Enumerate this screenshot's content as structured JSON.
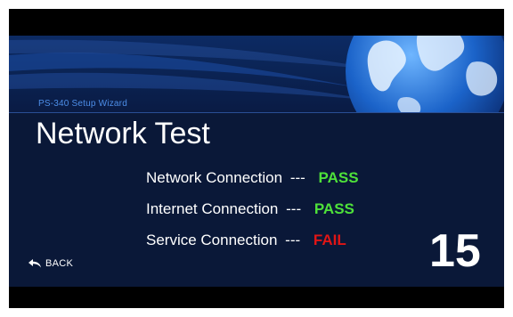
{
  "wizard": {
    "title": "PS-340 Setup Wizard"
  },
  "page": {
    "title": "Network Test"
  },
  "results": [
    {
      "label": "Network Connection",
      "separator": "---",
      "status": "PASS",
      "state": "pass"
    },
    {
      "label": "Internet Connection",
      "separator": "---",
      "status": "PASS",
      "state": "pass"
    },
    {
      "label": "Service Connection",
      "separator": "---",
      "status": "FAIL",
      "state": "fail"
    }
  ],
  "countdown": "15",
  "nav": {
    "back_label": "BACK",
    "back_icon": "back-arrow-icon"
  },
  "colors": {
    "background": "#0a1838",
    "header": "#0c2a63",
    "accent_text": "#4d8ee8",
    "pass": "#4ee13a",
    "fail": "#e01515"
  }
}
